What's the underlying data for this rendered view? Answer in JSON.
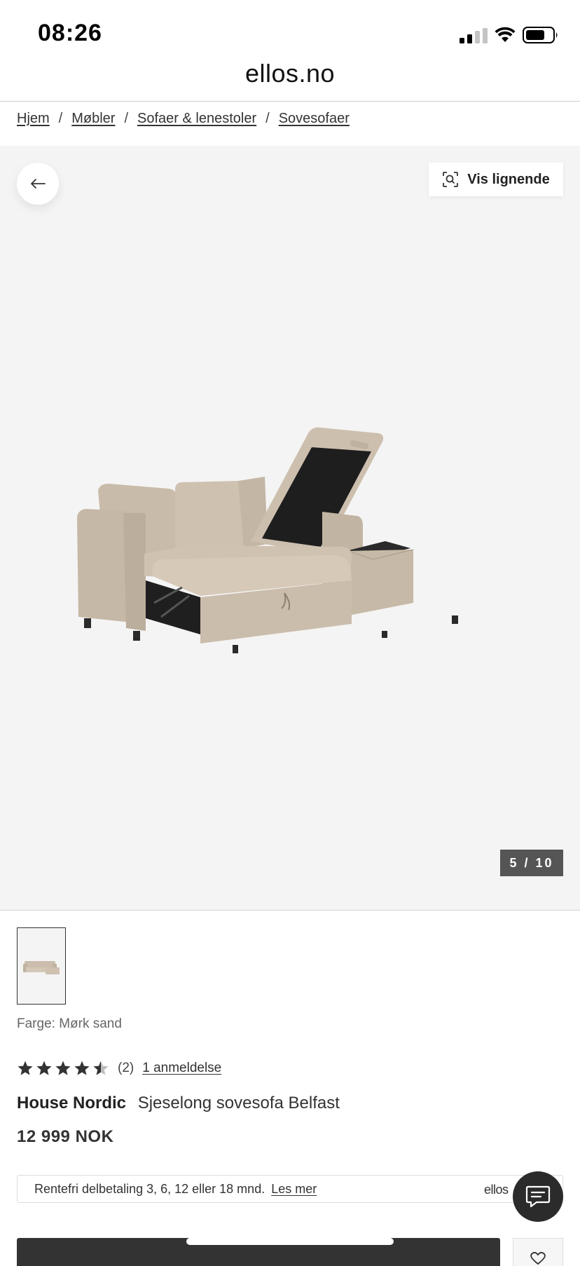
{
  "status_bar": {
    "time": "08:26",
    "icons": [
      "cellular-signal-icon",
      "wifi-icon",
      "battery-icon"
    ]
  },
  "header": {
    "site": "ellos.no"
  },
  "breadcrumb": {
    "items": [
      "Hjem",
      "Møbler",
      "Sofaer & lenestoler",
      "Sovesofaer"
    ],
    "separator": "/"
  },
  "gallery": {
    "similar_label": "Vis lignende",
    "counter": "5 / 10",
    "background": "#f4f4f4"
  },
  "product": {
    "color_label": "Farge: Mørk sand",
    "rating": 4.5,
    "rating_max": 5,
    "rating_count": "(2)",
    "review_link": "1 anmeldelse",
    "brand": "House Nordic",
    "title": "Sjeselong sovesofa Belfast",
    "price": "12 999 NOK"
  },
  "installment": {
    "text": "Rentefri delbetaling 3, 6, 12 eller 18 mnd.",
    "link": "Les mer",
    "brand": "ellos"
  },
  "colors": {
    "sofa": "#cbbcab",
    "dark_button": "#333333",
    "counter_bg": "#555555"
  }
}
